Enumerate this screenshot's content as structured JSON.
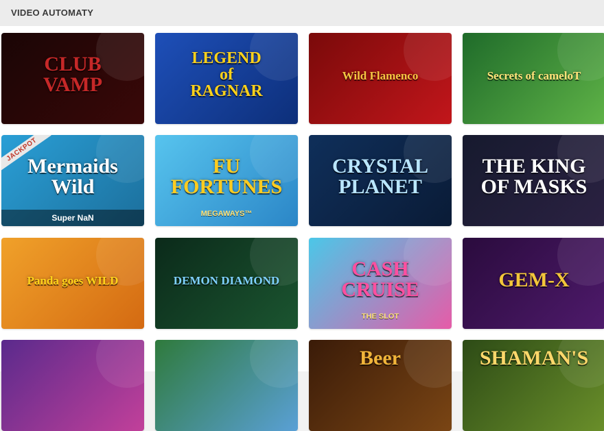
{
  "section": {
    "title": "VIDEO AUTOMATY"
  },
  "games": [
    {
      "name": "CLUB\nVAMP",
      "colors": [
        "#1a0505",
        "#3a0808"
      ],
      "text_color": "#c62828"
    },
    {
      "name": "LEGEND\nof\nRAGNAR",
      "colors": [
        "#1e4fb8",
        "#0d2f7a"
      ],
      "text_color": "#ffd21a"
    },
    {
      "name": "Wild Flamenco",
      "colors": [
        "#7a0a0a",
        "#c2161b"
      ],
      "text_color": "#f4c542"
    },
    {
      "name": "Secrets of cameloT",
      "colors": [
        "#1f6b2a",
        "#5fb347"
      ],
      "text_color": "#ffe27a"
    },
    {
      "name": "Mermaids\nWild",
      "badge": "JACKPOT",
      "caption": "Super NaN",
      "colors": [
        "#2a9fd6",
        "#1c6f9c"
      ],
      "text_color": "#ffffff"
    },
    {
      "name": "FU\nFORTUNES",
      "sub": "MEGAWAYS™",
      "colors": [
        "#57c4ee",
        "#2b86c7"
      ],
      "text_color": "#ffcc1f"
    },
    {
      "name": "CRYSTAL\nPLANET",
      "colors": [
        "#0f2f5a",
        "#0a1b36"
      ],
      "text_color": "#b9e6ff"
    },
    {
      "name": "THE KING\nOF MASKS",
      "colors": [
        "#161a2e",
        "#2b2142"
      ],
      "text_color": "#ffffff"
    },
    {
      "name": "Panda goes WILD",
      "colors": [
        "#f0a12a",
        "#d46a12"
      ],
      "text_color": "#ffd21a"
    },
    {
      "name": "DEMON DIAMOND",
      "colors": [
        "#0b2a1a",
        "#1b5530"
      ],
      "text_color": "#7fd1ff"
    },
    {
      "name": "CASH\nCRUISE",
      "sub": "THE SLOT",
      "colors": [
        "#4bc7e8",
        "#e65ca8"
      ],
      "text_color": "#ff4fa0"
    },
    {
      "name": "GEM-X",
      "colors": [
        "#2a0b3d",
        "#4e1a6b"
      ],
      "text_color": "#f3c63a"
    },
    {
      "name": "",
      "colors": [
        "#5a2a8c",
        "#c2409a"
      ],
      "text_color": "#ffffff"
    },
    {
      "name": "",
      "colors": [
        "#2f7a3c",
        "#5aa0d6"
      ],
      "text_color": "#ffffff"
    },
    {
      "name": "Beer",
      "colors": [
        "#3a1b08",
        "#7a4514"
      ],
      "text_color": "#f1b53a"
    },
    {
      "name": "SHAMAN'S",
      "colors": [
        "#2d4b16",
        "#6a8f2a"
      ],
      "text_color": "#ffd86b"
    }
  ]
}
